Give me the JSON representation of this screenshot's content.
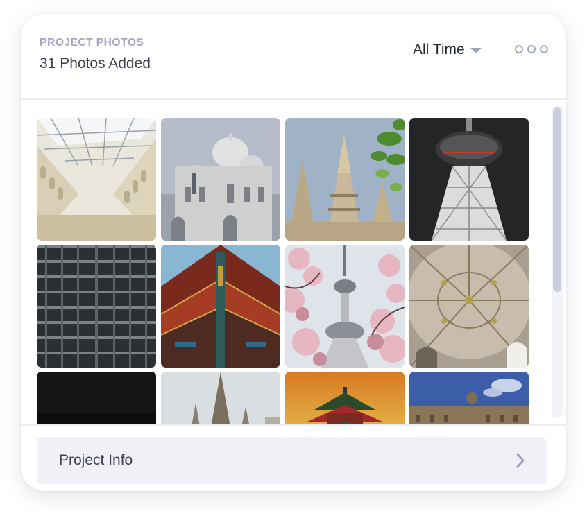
{
  "header": {
    "eyebrow": "PROJECT PHOTOS",
    "subtitle": "31 Photos Added",
    "filter_label": "All Time",
    "filter_icon": "chevron-down-icon",
    "more_icon": "more-horizontal-icon"
  },
  "gallery": {
    "photos": [
      {
        "subject": "glass-roof-atrium"
      },
      {
        "subject": "white-domed-basilica"
      },
      {
        "subject": "temple-spire-with-leaves"
      },
      {
        "subject": "lit-tv-tower-night"
      },
      {
        "subject": "skyscraper-facade"
      },
      {
        "subject": "pagoda-roof-eaves"
      },
      {
        "subject": "tower-cherry-blossoms"
      },
      {
        "subject": "vaulted-ceiling"
      },
      {
        "subject": "dark-night-scene"
      },
      {
        "subject": "gothic-cathedral-spires"
      },
      {
        "subject": "pagoda-sunset"
      },
      {
        "subject": "palace-blue-sky"
      }
    ]
  },
  "footer": {
    "info_label": "Project Info",
    "info_icon": "chevron-right-icon"
  },
  "colors": {
    "eyebrow": "#a6a8c2",
    "text": "#3b3f4f",
    "accent_icon": "#9ea3bd",
    "button_bg": "#f0f0f6"
  }
}
